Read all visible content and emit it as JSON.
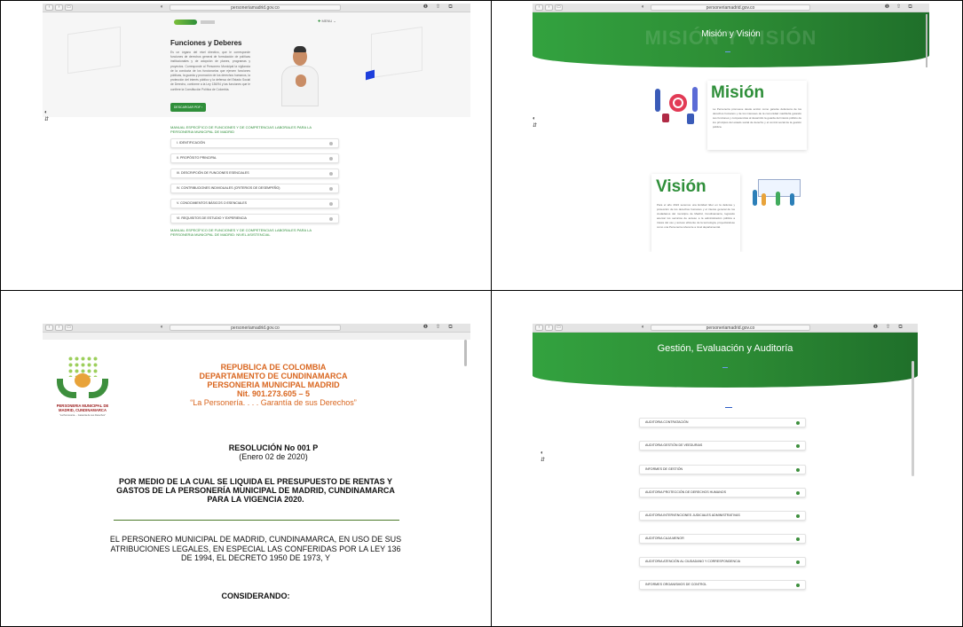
{
  "panel1": {
    "url": "personeriamadrid.gov.co",
    "menu_label": "MENU",
    "heading": "Funciones y Deberes",
    "paragraph": "Es un órgano del nivel directivo, que le corresponde funciones de derechos general de formulación de políticas institucionales y de adopción de planes, programas y proyectos. Corresponde al Personero Municipal la vigilancia de la conducta de los funcionarios que ejercen funciones públicas, la guarda y promoción de los derechos humanos, la protección del interés público y la defensa del Estado Social de Derecho, conforme a la Ley 136/94 y las funciones que le confiere la Constitución Política de Colombia.",
    "button_label": "DESCARGAR PDF",
    "section_title_1": "MANUAL ESPECÍFICO DE FUNCIONES Y DE COMPETENCIAS LABORALES PARA LA PERSONERIA MUNICIPAL DE MADRID",
    "items": [
      "I. IDENTIFICACIÓN",
      "II. PROPÓSITO PRINCIPAL",
      "III. DESCRIPCIÓN DE FUNCIONES ESENCIALES",
      "IV. CONTRIBUCIONES INDIVIDUALES (CRITERIOS DE DESEMPEÑO)",
      "V. CONOCIMIENTOS BÁSICOS O ESENCIALES",
      "VI. REQUISITOS DE ESTUDIO Y EXPERIENCIA"
    ],
    "section_title_2": "MANUAL ESPECÍFICO DE FUNCIONES Y DE COMPETENCIAS LABORALES PARA LA PERSONERIA MUNICIPAL DE MADRID: NIVEL ASISTENCIAL"
  },
  "panel2": {
    "url": "personeriamadrid.gov.co",
    "banner_title": "Misión y Visión",
    "banner_bg_text": "MISIÓN Y VISIÓN",
    "mision_title": "Misión",
    "mision_text": "La Personería promueve desde acción como garante defensora de los derechos humanos y de los intereses de la comunidad madrileña guiando sus funciones y competencias al desarrollo la guarda del interés público de los principios del estado social de derecho y el control social de la gestión pública.",
    "vision_title": "Visión",
    "vision_text": "Para el año 2024 seremos una Entidad líder en la defensa y protección de los derechos humanos y el interés general de los ciudadanos del municipio de Madrid, Cundinamarca, logrando acercar los servicios de acceso a la administración pública a través del uso y acceso eficiente de la tecnología, proyectándose como una Personería referente a nivel departamental."
  },
  "panel3": {
    "url": "personeriamadrid.gov.co",
    "logo_text_1": "PERSONERIA MUNICIPAL DE",
    "logo_text_2": "MADRID, CUNDINAMARCA",
    "logo_slogan": "\"La Personería.... Garantía de sus Derechos\"",
    "header_lines": [
      "REPUBLICA DE COLOMBIA",
      "DEPARTAMENTO DE CUNDINAMARCA",
      "PERSONERIA MUNICIPAL MADRID",
      "Nit. 901.273.605 – 5"
    ],
    "slogan": "“La Personería. . . . Garantía de sus Derechos”",
    "resolution": "RESOLUCIÓN  No 001  P",
    "resolution_date": "(Enero 02 de 2020)",
    "subject_lines": [
      "POR MEDIO DE LA CUAL SE LIQUIDA EL PRESUPUESTO DE RENTAS Y",
      "GASTOS DE LA PERSONERÍA MUNICIPAL DE MADRID, CUNDINAMARCA",
      "PARA LA VIGENCIA 2020."
    ],
    "body_lines": [
      "EL PERSONERO MUNICIPAL DE MADRID, CUNDINAMARCA, EN USO DE SUS",
      "ATRIBUCIONES LEGALES, EN ESPECIAL LAS CONFERIDAS POR LA LEY 136",
      "DE 1994, EL DECRETO 1950 DE 1973, Y"
    ],
    "considerando": "CONSIDERANDO:"
  },
  "panel4": {
    "url": "personeriamadrid.gov.co",
    "banner_title": "Gestión, Evaluación y Auditoría",
    "items": [
      "AUDITORIA CONTRATACIÓN",
      "AUDITORIA GESTIÓN DE VEEDURIAS",
      "INFORMES DE GESTIÓN",
      "AUDITORIA PROTECCIÓN DE DERECHOS HUMANOS",
      "AUDITORIA INTERVENCIONES JUDICIALES ADMINISTRATIVAS",
      "AUDITORIA CAJA MENOR",
      "AUDITORIA ATENCIÓN AL CIUDADANO Y CORRESPONDENCIA",
      "INFORMES ORGANISMOS DE CONTROL"
    ]
  },
  "colors": {
    "brand_green": "#2f8f3a",
    "doc_orange": "#d9661f",
    "doc_rule": "#4a7a2a"
  }
}
